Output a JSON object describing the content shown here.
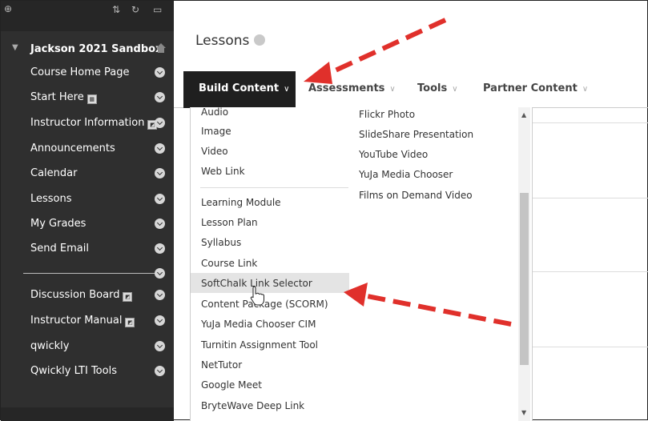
{
  "sidebar": {
    "course_title": "Jackson 2021 Sandbox",
    "items": [
      {
        "label": "Course Home Page"
      },
      {
        "label": "Start Here"
      },
      {
        "label": "Instructor Information"
      },
      {
        "label": "Announcements"
      },
      {
        "label": "Calendar"
      },
      {
        "label": "Lessons"
      },
      {
        "label": "My Grades"
      },
      {
        "label": "Send Email"
      },
      {
        "label": "Discussion Board"
      },
      {
        "label": "Instructor Manual"
      },
      {
        "label": "qwickly"
      },
      {
        "label": "Qwickly LTI Tools"
      }
    ]
  },
  "page": {
    "title": "Lessons"
  },
  "tabs": {
    "build": "Build Content",
    "assessments": "Assessments",
    "tools": "Tools",
    "partner": "Partner Content"
  },
  "dropdown": {
    "col1_top": [
      "Audio",
      "Image",
      "Video",
      "Web Link"
    ],
    "col1_bottom": [
      "Learning Module",
      "Lesson Plan",
      "Syllabus",
      "Course Link",
      "SoftChalk Link Selector",
      "Content Package (SCORM)",
      "YuJa Media Chooser CIM",
      "Turnitin Assignment Tool",
      "NetTutor",
      "Google Meet",
      "BryteWave Deep Link"
    ],
    "col2": [
      "Flickr Photo",
      "SlideShare Presentation",
      "YouTube Video",
      "YuJa Media Chooser",
      "Films on Demand Video"
    ],
    "highlighted": "SoftChalk Link Selector"
  },
  "colors": {
    "arrow": "#e0302b",
    "tab_active_bg": "#1f1f1f",
    "sidebar_bg": "#2f2f2f"
  }
}
